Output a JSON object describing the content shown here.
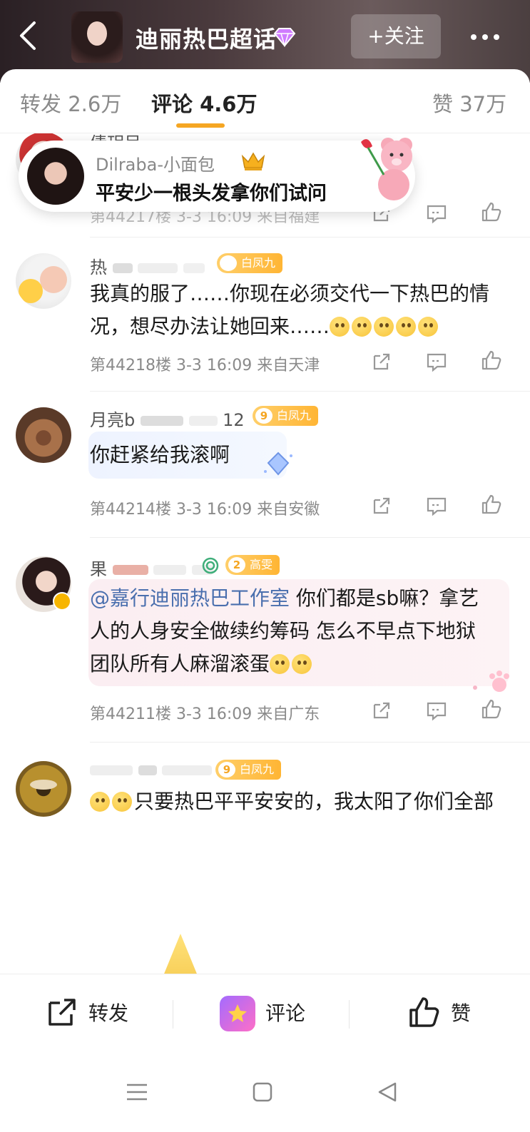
{
  "header": {
    "title": "迪丽热巴超话",
    "follow_label": "+关注"
  },
  "tabs": [
    {
      "label": "转发 2.6万"
    },
    {
      "label": "评论 4.6万"
    },
    {
      "label": "赞 37万"
    }
  ],
  "pinned_toast": {
    "name": "Dilraba-小面包",
    "text": "平安少一根头发拿你们试问"
  },
  "comments": [
    {
      "name_fragment": "倩玥呆",
      "meta": "第44217楼 3-3 16:09 来自福建"
    },
    {
      "name_fragment": "热",
      "badge": "白凤九",
      "badge_num": "",
      "text": "我真的服了……你现在必须交代一下热巴的情况，想尽办法让她回来……",
      "meta": "第44218楼 3-3 16:09 来自天津"
    },
    {
      "name_fragment": "月亮b",
      "name_tail": "12",
      "badge": "白凤九",
      "badge_num": "9",
      "text": "你赶紧给我滚啊",
      "meta": "第44214楼 3-3 16:09 来自安徽"
    },
    {
      "name_fragment": "果",
      "badge": "高雯",
      "badge_num": "2",
      "mention": "@嘉行迪丽热巴工作室",
      "text": " 你们都是sb嘛？拿艺人的人身安全做续约筹码 怎么不早点下地狱 团队所有人麻溜滚蛋",
      "meta": "第44211楼 3-3 16:09 来自广东"
    },
    {
      "name_fragment": "",
      "badge": "白凤九",
      "badge_num": "9",
      "text": "只要热巴平平安安的，我太阳了你们全部"
    }
  ],
  "bottom_bar": {
    "repost_label": "转发",
    "comment_label": "评论",
    "like_label": "赞"
  },
  "colors": {
    "accent": "#f5a623",
    "mention": "#4a6fae",
    "badge": "#ffb534"
  }
}
